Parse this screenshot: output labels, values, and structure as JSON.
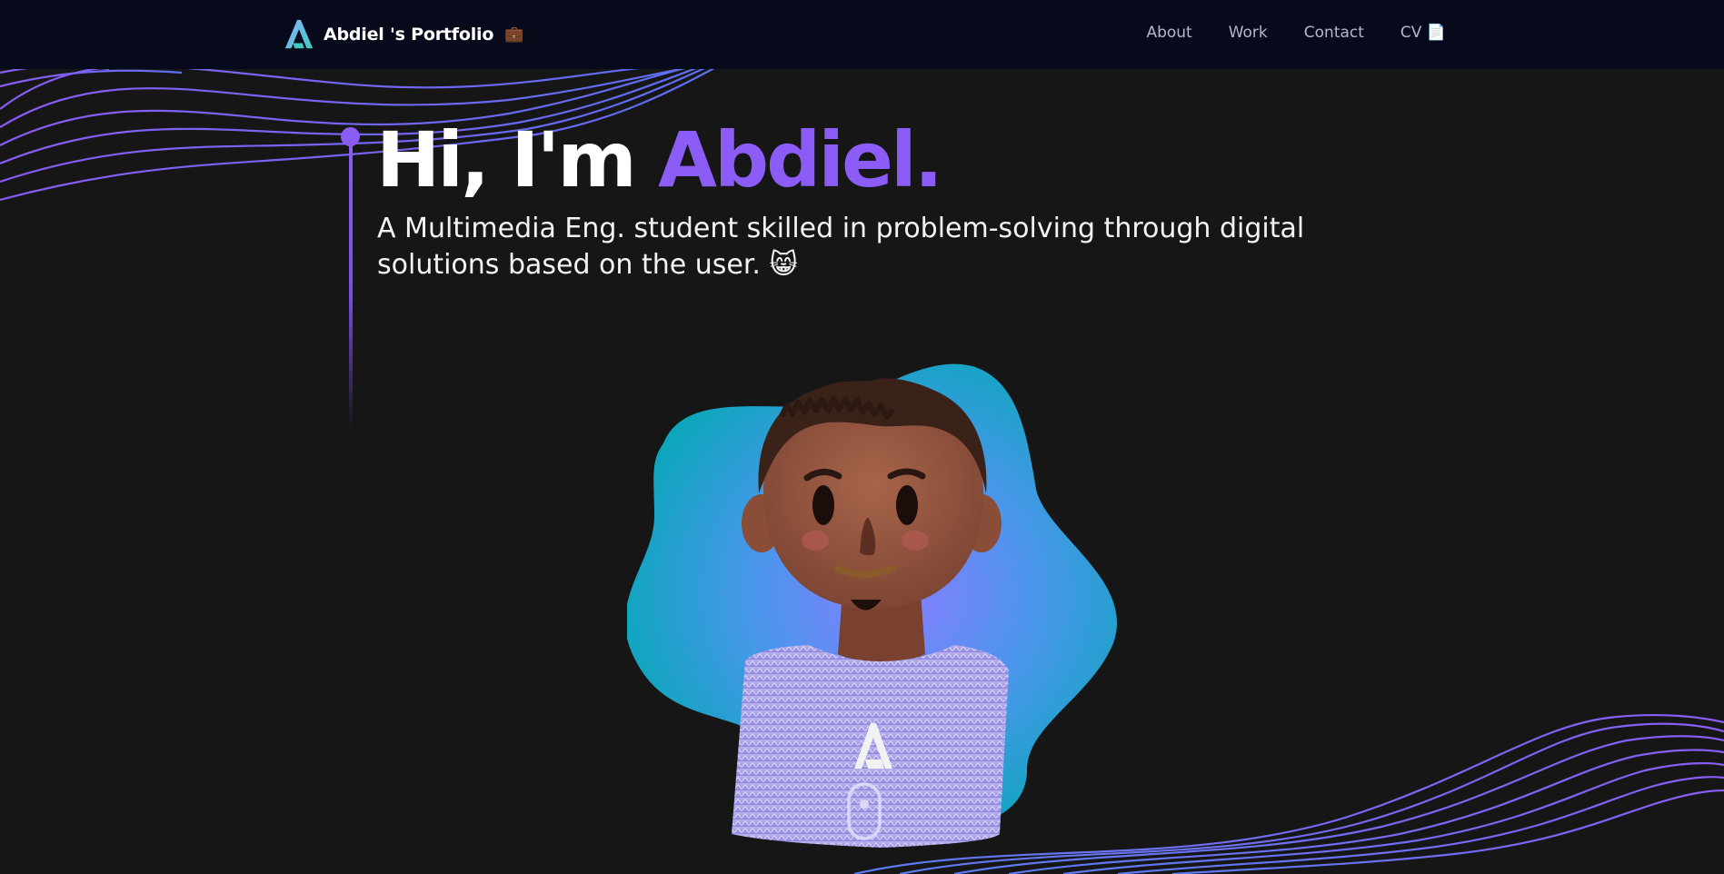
{
  "navbar": {
    "brand_text": "Abdiel 's Portfolio",
    "brand_emoji": "💼",
    "links": [
      {
        "label": "About"
      },
      {
        "label": "Work"
      },
      {
        "label": "Contact"
      },
      {
        "label": "CV 📄"
      }
    ]
  },
  "hero": {
    "greeting": "Hi, I'm ",
    "name": "Abdiel.",
    "subtitle": "A Multimedia Eng. student skilled in problem-solving through digital solutions based on the user. 😸"
  },
  "colors": {
    "accent": "#8b5cf6",
    "navbar_bg": "#070a1a",
    "page_bg": "#161616",
    "blob_teal": "#06a8b8",
    "blob_blue": "#5b8ef0"
  },
  "icons": {
    "logo": "a-logo-icon",
    "scroll": "mouse-scroll-icon"
  }
}
